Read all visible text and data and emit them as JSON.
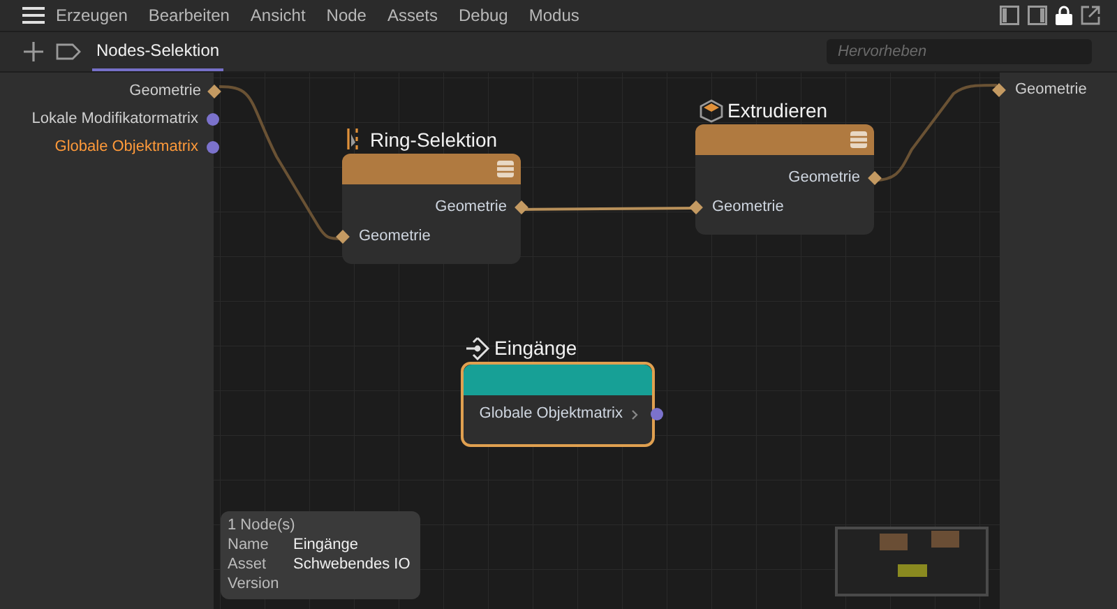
{
  "menu": [
    "Erzeugen",
    "Bearbeiten",
    "Ansicht",
    "Node",
    "Assets",
    "Debug",
    "Modus"
  ],
  "tabs": [
    {
      "label": "Nodes-Selektion",
      "selected": true
    }
  ],
  "search": {
    "placeholder": "Hervorheben"
  },
  "left_ports": [
    {
      "label": "Geometrie",
      "kind": "diamond",
      "highlighted": false
    },
    {
      "label": "Lokale Modifikatormatrix",
      "kind": "circle",
      "highlighted": false
    },
    {
      "label": "Globale Objektmatrix",
      "kind": "circle",
      "highlighted": true
    }
  ],
  "right_ports": [
    {
      "label": "Geometrie",
      "kind": "diamond"
    }
  ],
  "nodes": [
    {
      "title": "Ring-Selektion",
      "kind": "ring",
      "color": "#b07a40",
      "selected": false,
      "outputs": [
        {
          "label": "Geometrie",
          "kind": "diamond"
        }
      ],
      "inputs": [
        {
          "label": "Geometrie",
          "kind": "diamond"
        }
      ]
    },
    {
      "title": "Extrudieren",
      "kind": "cube",
      "color": "#b07a40",
      "selected": false,
      "outputs": [
        {
          "label": "Geometrie",
          "kind": "diamond"
        }
      ],
      "inputs": [
        {
          "label": "Geometrie",
          "kind": "diamond"
        }
      ]
    },
    {
      "title": "Eingänge",
      "kind": "input",
      "color": "#17a096",
      "selected": true,
      "outputs": [
        {
          "label": "Globale Objektmatrix",
          "kind": "circle"
        }
      ]
    }
  ],
  "info": {
    "header": "1 Node(s)",
    "rows": [
      {
        "label": "Name",
        "value": "Eingänge"
      },
      {
        "label": "Asset",
        "value": "Schwebendes IO"
      },
      {
        "label": "Version"
      }
    ]
  }
}
